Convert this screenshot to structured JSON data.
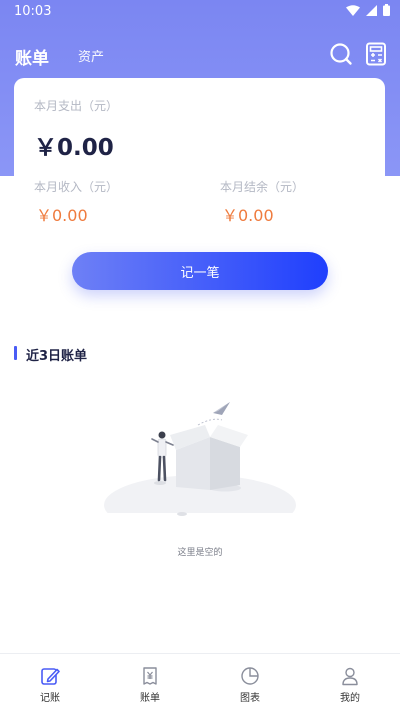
{
  "status_bar": {
    "time": "10:03"
  },
  "topnav": {
    "active_tab": "账单",
    "other_tab": "资产"
  },
  "summary": {
    "expense_label": "本月支出（元）",
    "expense_value": "￥0.00",
    "income_label": "本月收入（元）",
    "income_value": "￥0.00",
    "balance_label": "本月结余（元）",
    "balance_value": "￥0.00"
  },
  "record_button": "记一笔",
  "recent": {
    "title": "近3日账单",
    "empty_text": "这里是空的"
  },
  "bottom_nav": [
    {
      "label": "记账",
      "icon": "edit-icon"
    },
    {
      "label": "账单",
      "icon": "bill-icon"
    },
    {
      "label": "图表",
      "icon": "chart-icon"
    },
    {
      "label": "我的",
      "icon": "user-icon"
    }
  ],
  "colors": {
    "header": "#7b86f2",
    "accent": "#1f3ffd",
    "amount_orange": "#ef7b3e",
    "active_icon": "#4a5cf5"
  }
}
